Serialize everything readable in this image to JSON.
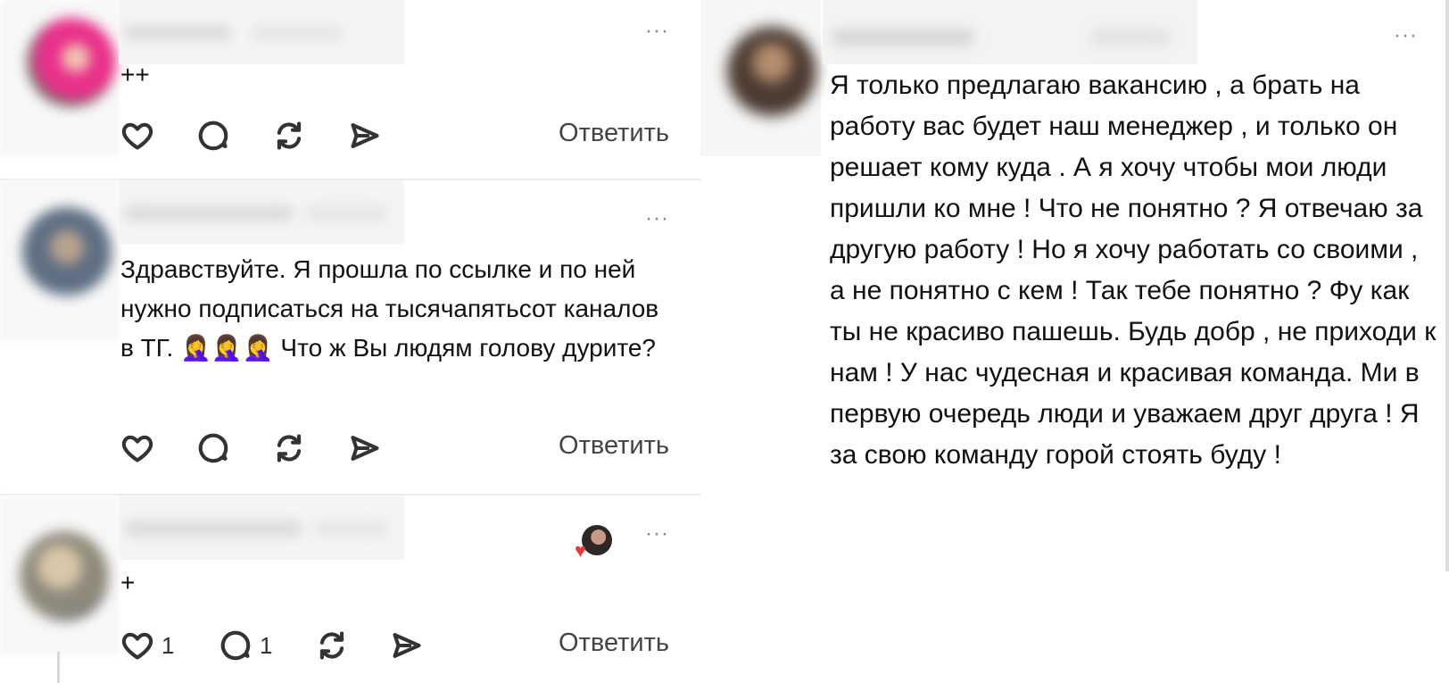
{
  "comments": [
    {
      "text": "++",
      "likes": "",
      "replies": "",
      "reply_label": "Ответить",
      "more_label": "···"
    },
    {
      "text": "Здравствуйте. Я прошла по ссылке и по ней нужно подписаться на тысячапятьсот каналов в ТГ. 🤦‍♀️🤦‍♀️🤦‍♀️ Что ж Вы людям голову дурите?",
      "likes": "",
      "replies": "",
      "reply_label": "Ответить",
      "more_label": "···"
    },
    {
      "text": "+",
      "likes": "1",
      "replies": "1",
      "reply_label": "Ответить",
      "more_label": "···",
      "liked_by_author": true
    }
  ],
  "right_comment": {
    "text": "Я только предлагаю вакансию , а брать на работу вас будет наш менеджер , и только он решает кому куда . А я хочу чтобы мои люди пришли ко мне ! Что не понятно ? Я отвечаю за другую работу ! Но я хочу работать со своими , а не понятно с кем ! Так тебе понятно ? Фу как ты не красиво пашешь. Будь добр , не приходи к нам ! У нас чудесная и красивая команда. Ми в первую очередь люди и уважаем друг друга ! Я за свою команду горой стоять буду !",
    "more_label": "···"
  },
  "icons": [
    "heart-icon",
    "comment-icon",
    "repost-icon",
    "share-icon",
    "more-icon"
  ],
  "colors": {
    "text": "#111111",
    "icon": "#333333",
    "heart_badge": "#e53a3a",
    "divider": "#ececec"
  }
}
